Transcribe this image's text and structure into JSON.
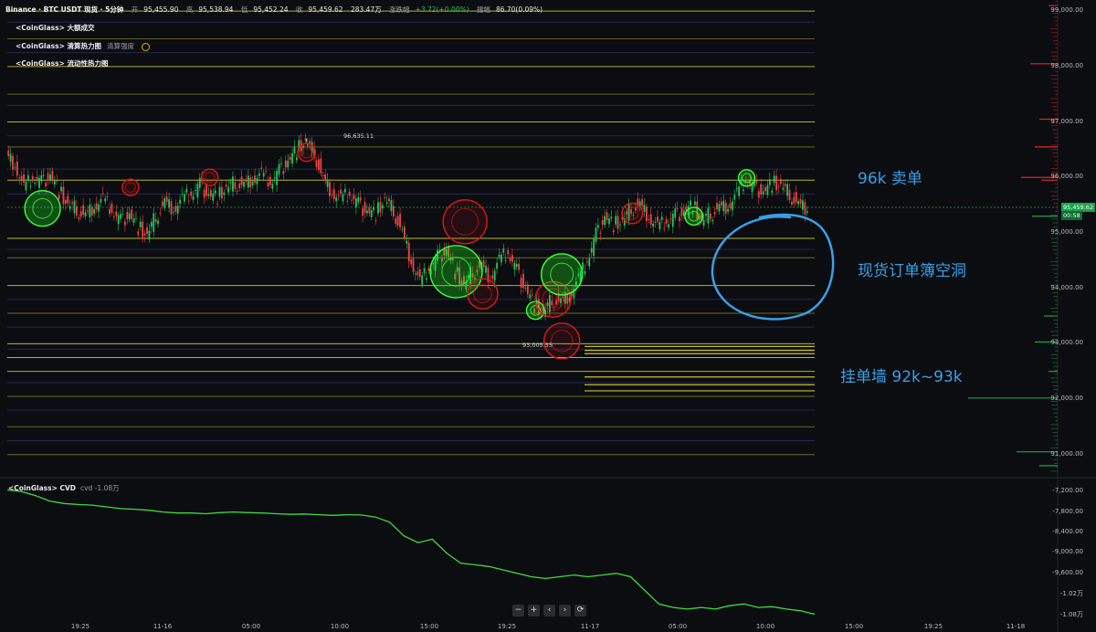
{
  "header": {
    "symbol": "Binance · BTC USDT 现货 · 5分钟",
    "open_label": "开",
    "open": "95,455.90",
    "high_label": "高",
    "high": "95,538.94",
    "low_label": "低",
    "low": "95,452.24",
    "close_label": "收",
    "close": "95,459.62",
    "volume": "283.47万",
    "change_label": "涨跌幅",
    "change": "+3.72(+0.00%)",
    "amp_label": "振幅",
    "amp": "86.70(0.09%)"
  },
  "indicators": [
    {
      "label": "<CoinGlass> 大额成交",
      "sub": ""
    },
    {
      "label": "<CoinGlass> 清算热力图",
      "sub": "清算强度"
    },
    {
      "label": "<CoinGlass> 流动性热力图",
      "sub": ""
    }
  ],
  "cvd": {
    "label": "<CoinGlass> CVD",
    "sub": "cvd -1.08万"
  },
  "annotations": {
    "sell_wall": "96k 卖单",
    "spot_gap": "现货订单簿空洞",
    "buy_wall": "挂单墙 92k~93k"
  },
  "markers": {
    "high": "96,635.11",
    "low": "93,005.55"
  },
  "price_tag": {
    "value": "95,459.62",
    "countdown": "00:58"
  },
  "nav_buttons": [
    "−",
    "+",
    "‹",
    "›",
    "⟳"
  ],
  "colors": {
    "background": "#0c0d11",
    "up": "#22c55e",
    "down": "#ef4444",
    "liquidity_line": "#d9d43a",
    "annotation": "#3aa0e6",
    "cvd_line": "#3ddc3d"
  },
  "chart_data": [
    {
      "type": "line",
      "title": "Binance · BTC USDT 现货 · 5分钟",
      "y_axis": [
        "97,000.00",
        "96,000.00",
        "95,000.00",
        "94,000.00",
        "93,000.00",
        "92,000.00",
        "91,000.00"
      ],
      "y_axis_partial": [
        "99,000.00",
        "98,000.00"
      ],
      "ylim": [
        90600,
        99200
      ],
      "x_axis": [
        "19:25",
        "11-16",
        "05:00",
        "10:00",
        "15:00",
        "19:25",
        "11-17",
        "05:00",
        "10:00",
        "15:00",
        "19:25",
        "11-18"
      ],
      "series": [
        {
          "values": [
            96380,
            96250,
            95800,
            96000,
            95900,
            96050,
            95750,
            95500,
            95420,
            95300,
            95500,
            95600,
            95400,
            95200,
            95350,
            95100,
            94950,
            95300,
            95550,
            95450,
            95600,
            95700,
            95850,
            95700,
            95650,
            95800,
            95900,
            95850,
            96000,
            96050,
            95900,
            96100,
            96300,
            96500,
            96635,
            96450,
            95950,
            95750,
            95600,
            95700,
            95500,
            95400,
            95350,
            95600,
            95400,
            95000,
            94500,
            94100,
            94350,
            94550,
            94700,
            94300,
            94050,
            94300,
            94400,
            94200,
            94500,
            94650,
            94300,
            94000,
            93700,
            93550,
            93800,
            93750,
            93900,
            94150,
            94500,
            94950,
            95300,
            95150,
            95200,
            95450,
            95500,
            95300,
            95100,
            95200,
            95300,
            95400,
            95500,
            95200,
            95350,
            95450,
            95500,
            95700,
            95950,
            95800,
            95750,
            95900,
            95850,
            95700,
            95500,
            95459.62
          ]
        }
      ],
      "liquidity_levels": [
        {
          "price": 99000,
          "intensity": 0.9
        },
        {
          "price": 98500,
          "intensity": 0.6
        },
        {
          "price": 98000,
          "intensity": 0.9
        },
        {
          "price": 97500,
          "intensity": 0.7
        },
        {
          "price": 97000,
          "intensity": 0.9
        },
        {
          "price": 96550,
          "intensity": 0.7
        },
        {
          "price": 95950,
          "intensity": 1.0
        },
        {
          "price": 94900,
          "intensity": 1.0
        },
        {
          "price": 94550,
          "intensity": 0.8
        },
        {
          "price": 94050,
          "intensity": 0.9
        },
        {
          "price": 93550,
          "intensity": 0.8
        },
        {
          "price": 93000,
          "intensity": 1.0
        },
        {
          "price": 92750,
          "intensity": 1.0
        },
        {
          "price": 92500,
          "intensity": 0.9
        },
        {
          "price": 92050,
          "intensity": 0.8
        },
        {
          "price": 91500,
          "intensity": 0.7
        },
        {
          "price": 91000,
          "intensity": 0.8
        }
      ],
      "liquidation_bubbles": [
        {
          "i": 4,
          "price": 95440,
          "side": "buy",
          "size": 2.6
        },
        {
          "i": 14,
          "price": 95820,
          "side": "sell",
          "size": 1.2
        },
        {
          "i": 23,
          "price": 96000,
          "side": "sell",
          "size": 1.2
        },
        {
          "i": 34,
          "price": 96450,
          "side": "sell",
          "size": 1.3
        },
        {
          "i": 52,
          "price": 95200,
          "side": "sell",
          "size": 3.2
        },
        {
          "i": 51,
          "price": 94300,
          "side": "buy",
          "size": 3.8
        },
        {
          "i": 54,
          "price": 93900,
          "side": "sell",
          "size": 2.2
        },
        {
          "i": 60,
          "price": 93600,
          "side": "buy",
          "size": 1.3
        },
        {
          "i": 62,
          "price": 93800,
          "side": "sell",
          "size": 2.6
        },
        {
          "i": 63,
          "price": 94250,
          "side": "buy",
          "size": 3.0
        },
        {
          "i": 63,
          "price": 93050,
          "side": "sell",
          "size": 2.6
        },
        {
          "i": 71,
          "price": 95350,
          "side": "sell",
          "size": 1.5
        },
        {
          "i": 78,
          "price": 95300,
          "side": "buy",
          "size": 1.3
        },
        {
          "i": 84,
          "price": 95990,
          "side": "buy",
          "size": 1.2
        }
      ]
    },
    {
      "type": "line",
      "title": "<CoinGlass> CVD",
      "y_axis": [
        "-7,200.00",
        "-7,800.00",
        "-8,400.00",
        "-9,000.00",
        "-9,600.00",
        "-1.02万",
        "-1.08万"
      ],
      "ylim": [
        -11000,
        -6900
      ],
      "series": [
        {
          "values": [
            -7150,
            -7200,
            -7320,
            -7480,
            -7550,
            -7580,
            -7600,
            -7650,
            -7700,
            -7720,
            -7750,
            -7800,
            -7830,
            -7830,
            -7850,
            -7820,
            -7800,
            -7820,
            -7830,
            -7850,
            -7870,
            -7860,
            -7880,
            -7900,
            -7880,
            -7890,
            -7950,
            -8100,
            -8500,
            -8700,
            -8600,
            -9000,
            -9300,
            -9350,
            -9400,
            -9500,
            -9600,
            -9700,
            -9750,
            -9700,
            -9650,
            -9700,
            -9650,
            -9600,
            -9700,
            -10100,
            -10500,
            -10600,
            -10650,
            -10600,
            -10650,
            -10550,
            -10500,
            -10600,
            -10580,
            -10650,
            -10700,
            -10800
          ]
        }
      ]
    }
  ]
}
